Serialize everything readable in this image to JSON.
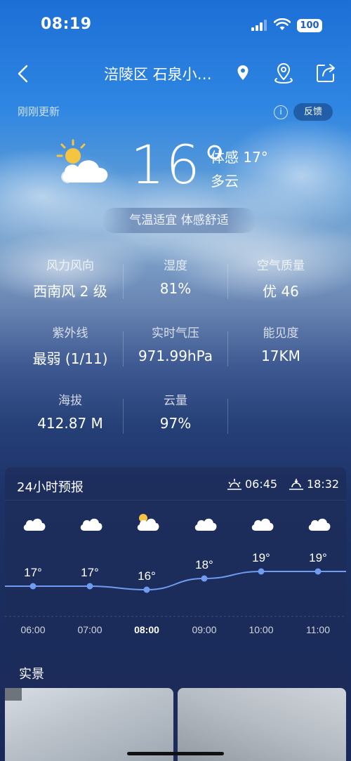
{
  "status_bar": {
    "time": "08:19",
    "battery": "100"
  },
  "nav": {
    "title": "涪陵区 石泉小…"
  },
  "update": {
    "text": "刚刚更新",
    "info_icon": "i",
    "feedback": "反馈"
  },
  "current": {
    "icon": "partly-cloudy-icon",
    "temperature": "16°",
    "feels_like": "体感 17°",
    "condition": "多云",
    "comfort": "气温适宜 体感舒适"
  },
  "details": [
    {
      "label": "风力风向",
      "value": "西南风 2 级"
    },
    {
      "label": "湿度",
      "value": "81%"
    },
    {
      "label": "空气质量",
      "value": "优 46"
    },
    {
      "label": "紫外线",
      "value": "最弱 (1/11)"
    },
    {
      "label": "实时气压",
      "value": "971.99hPa"
    },
    {
      "label": "能见度",
      "value": "17KM"
    },
    {
      "label": "海拔",
      "value": "412.87 M"
    },
    {
      "label": "云量",
      "value": "97%"
    }
  ],
  "forecast": {
    "title": "24小时预报",
    "sunrise": "06:45",
    "sunset": "18:32",
    "hours": [
      {
        "time": "06:00",
        "temp": "17°",
        "icon": "cloudy-icon"
      },
      {
        "time": "07:00",
        "temp": "17°",
        "icon": "cloudy-icon"
      },
      {
        "time": "08:00",
        "temp": "16°",
        "icon": "partly-cloudy-icon"
      },
      {
        "time": "09:00",
        "temp": "18°",
        "icon": "cloudy-icon"
      },
      {
        "time": "10:00",
        "temp": "19°",
        "icon": "cloudy-icon"
      },
      {
        "time": "11:00",
        "temp": "19°",
        "icon": "cloudy-icon"
      }
    ],
    "temp_values": [
      17,
      17,
      16,
      18,
      19,
      19
    ],
    "line_color": "#6f9bf0"
  },
  "live": {
    "title": "实景"
  }
}
